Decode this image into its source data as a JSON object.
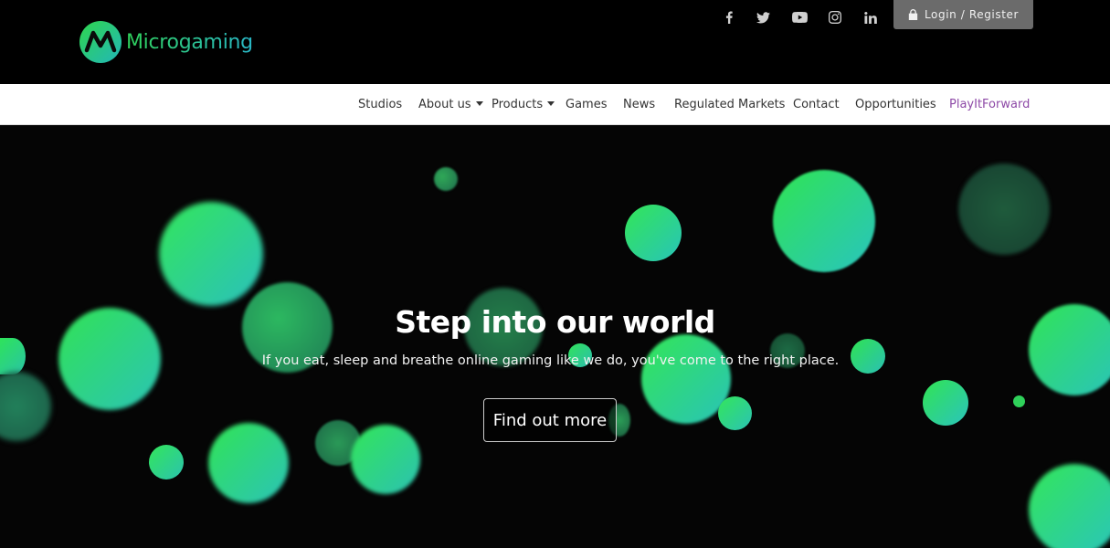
{
  "brand": {
    "name": "Microgaming"
  },
  "social": [
    {
      "name": "facebook-icon",
      "glyph": "f"
    },
    {
      "name": "twitter-icon",
      "glyph": "twitter"
    },
    {
      "name": "youtube-icon",
      "glyph": "youtube"
    },
    {
      "name": "instagram-icon",
      "glyph": "instagram"
    },
    {
      "name": "linkedin-icon",
      "glyph": "in"
    }
  ],
  "header": {
    "login_label": "Login / Register"
  },
  "nav": {
    "studios": "Studios",
    "about": "About us",
    "products": "Products",
    "games": "Games",
    "news": "News",
    "regulated": "Regulated Markets",
    "contact": "Contact",
    "opportunities": "Opportunities",
    "playitforward": "PlayItForward"
  },
  "hero": {
    "title": "Step into our world",
    "subtitle": "If you eat, sleep and breathe online gaming like we do, you've come to the right place.",
    "cta_label": "Find out more"
  },
  "colors": {
    "accent_green": "#2ed84f",
    "accent_teal": "#2bb8c4",
    "active_nav": "#8e4aa7"
  }
}
